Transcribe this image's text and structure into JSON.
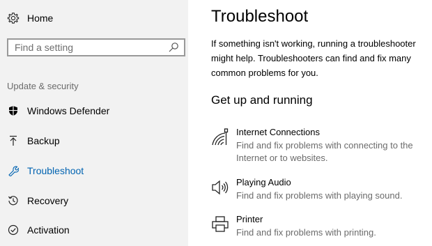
{
  "sidebar": {
    "home_label": "Home",
    "search": {
      "placeholder": "Find a setting",
      "value": ""
    },
    "section_label": "Update & security",
    "items": [
      {
        "label": "Windows Defender",
        "icon": "shield-icon"
      },
      {
        "label": "Backup",
        "icon": "upload-arrow-icon"
      },
      {
        "label": "Troubleshoot",
        "icon": "wrench-icon",
        "active": true
      },
      {
        "label": "Recovery",
        "icon": "history-icon"
      },
      {
        "label": "Activation",
        "icon": "check-circle-icon"
      }
    ]
  },
  "main": {
    "title": "Troubleshoot",
    "intro": "If something isn't working, running a troubleshooter might help. Troubleshooters can find and fix many common problems for you.",
    "section_title": "Get up and running",
    "troubleshooters": [
      {
        "name": "Internet Connections",
        "description": "Find and fix problems with connecting to the Internet or to websites.",
        "icon": "wifi-network-icon"
      },
      {
        "name": "Playing Audio",
        "description": "Find and fix problems with playing sound.",
        "icon": "speaker-icon"
      },
      {
        "name": "Printer",
        "description": "Find and fix problems with printing.",
        "icon": "printer-icon"
      }
    ]
  },
  "colors": {
    "accent": "#0063b1",
    "sidebar_bg": "#f2f2f2",
    "secondary_text": "#6b6b6b"
  }
}
